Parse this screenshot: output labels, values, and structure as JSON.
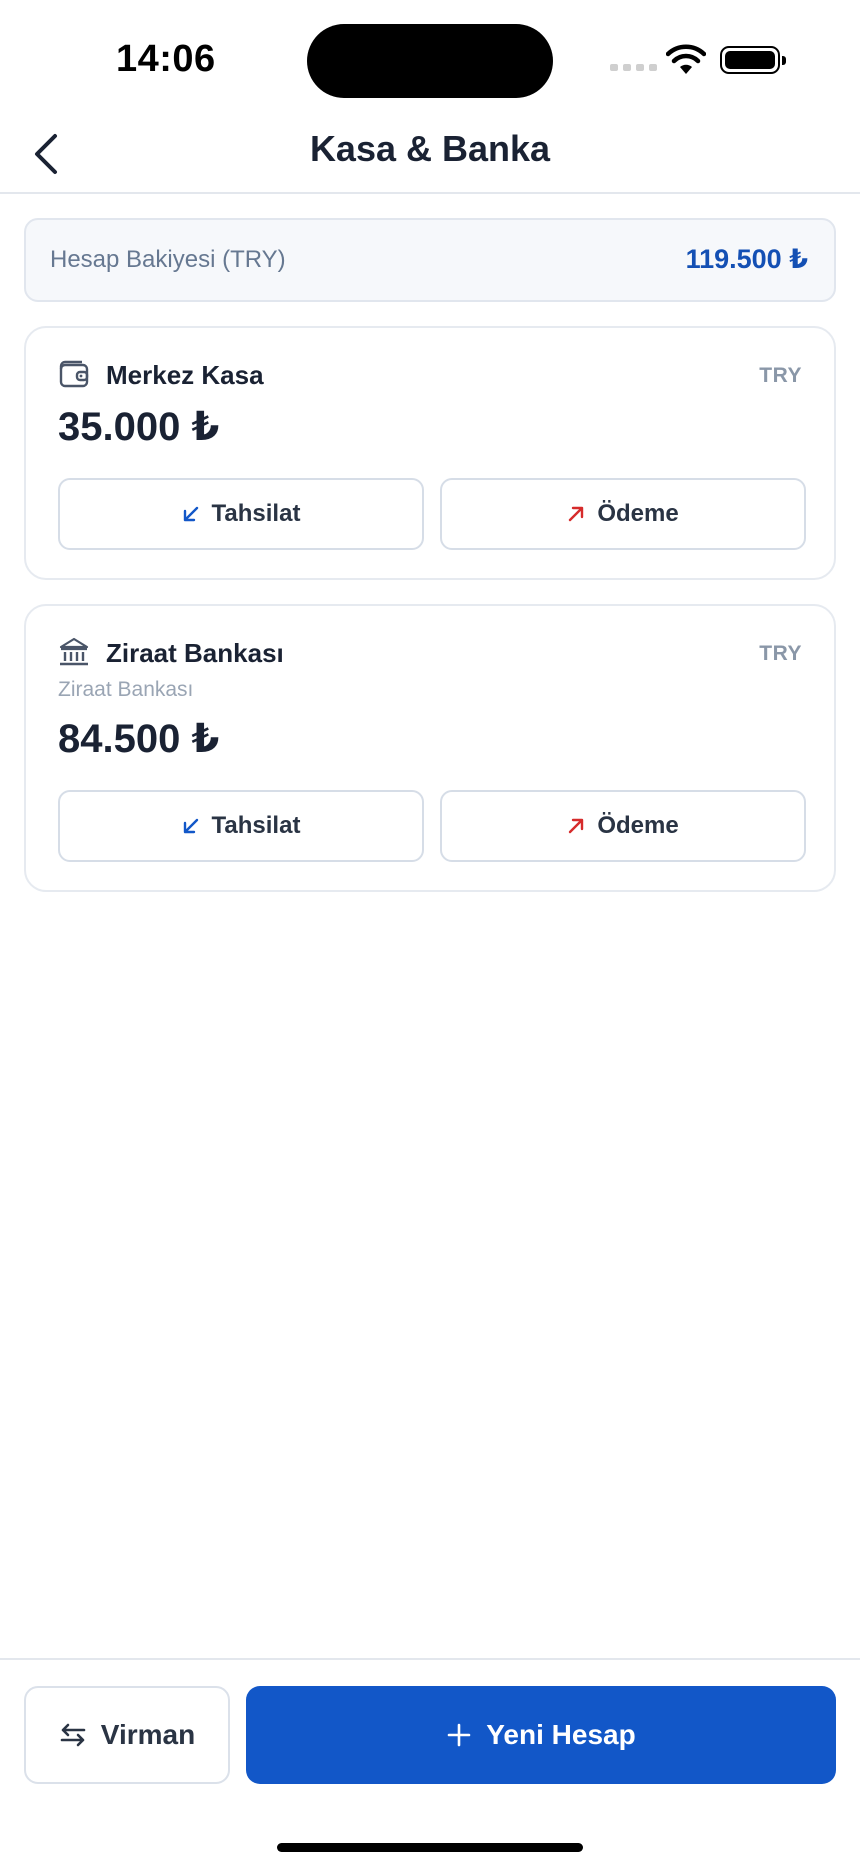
{
  "status_bar": {
    "time": "14:06"
  },
  "header": {
    "title": "Kasa & Banka"
  },
  "summary": {
    "label": "Hesap Bakiyesi (TRY)",
    "value": "119.500 ₺"
  },
  "accounts": [
    {
      "name": "Merkez Kasa",
      "currency": "TRY",
      "subtitle": "",
      "balance": "35.000 ₺",
      "icon": "wallet-icon",
      "collect_label": "Tahsilat",
      "pay_label": "Ödeme"
    },
    {
      "name": "Ziraat Bankası",
      "currency": "TRY",
      "subtitle": "Ziraat Bankası",
      "balance": "84.500 ₺",
      "icon": "bank-icon",
      "collect_label": "Tahsilat",
      "pay_label": "Ödeme"
    }
  ],
  "footer": {
    "transfer_label": "Virman",
    "new_account_label": "Yeni Hesap"
  },
  "colors": {
    "primary": "#1257c8",
    "balance_accent": "#1450b4",
    "collect_icon": "#1257c8",
    "pay_icon": "#d62b2b"
  }
}
